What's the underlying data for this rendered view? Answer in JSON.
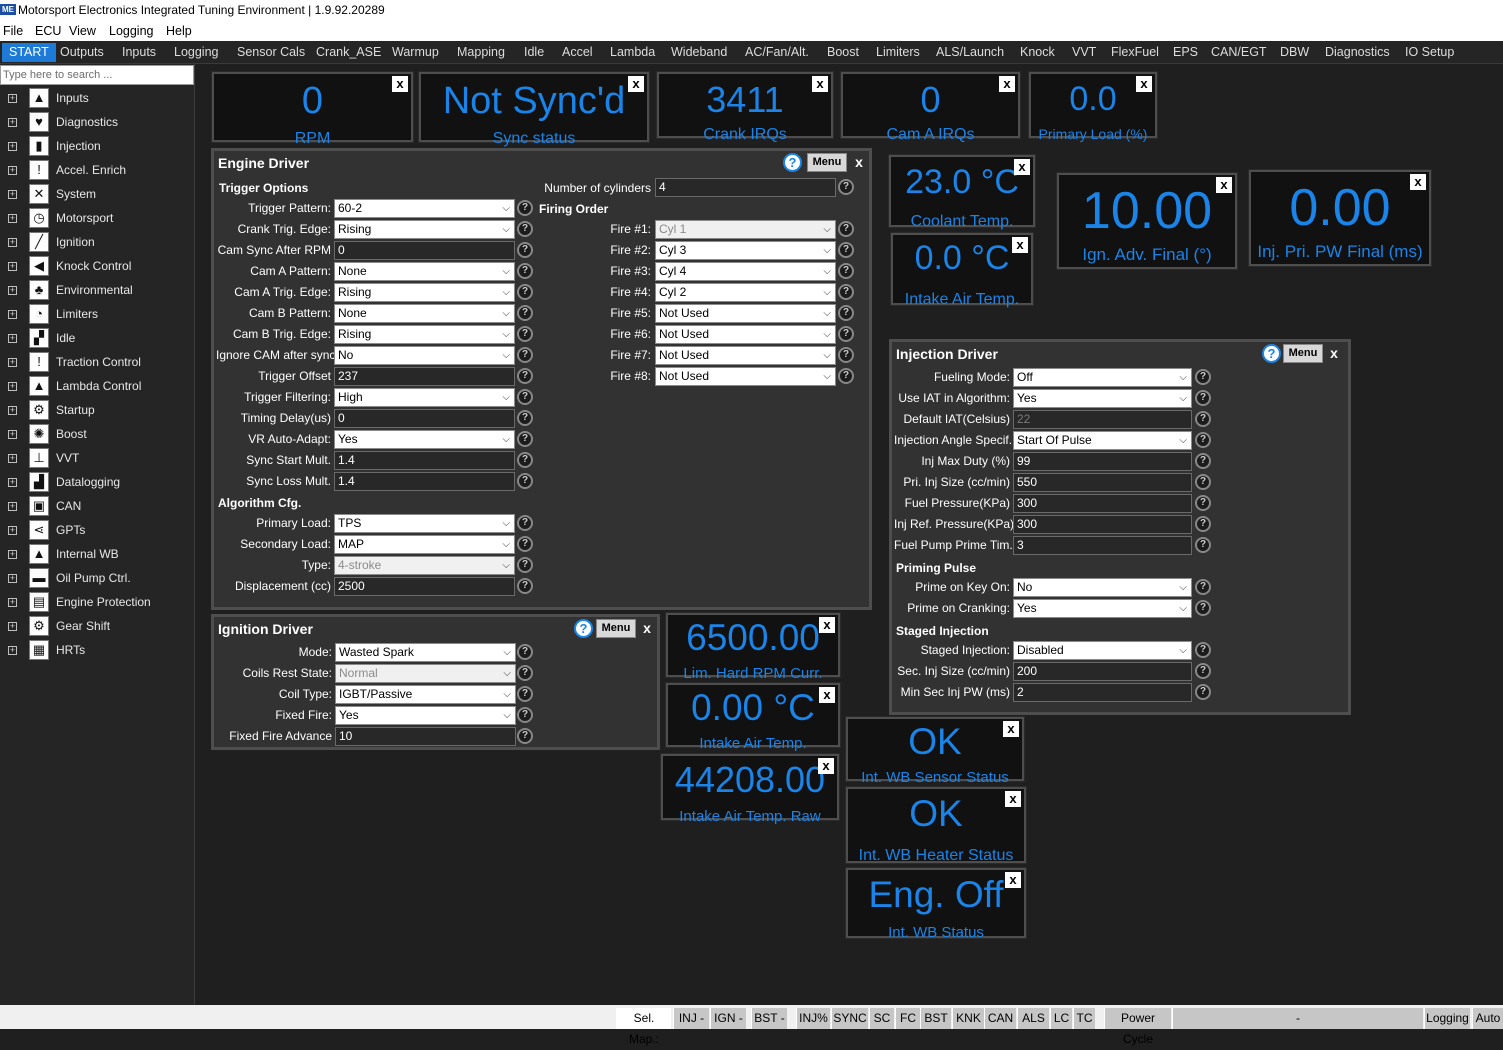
{
  "window": {
    "title": "Motorsport Electronics Integrated Tuning Environment | 1.9.92.20289",
    "logo": "ME"
  },
  "menu": [
    "File",
    "ECU",
    "View",
    "Logging",
    "Help"
  ],
  "tabs": [
    "START",
    "Outputs",
    "Inputs",
    "Logging",
    "Sensor Cals",
    "Crank_ASE",
    "Warmup",
    "Mapping",
    "Idle",
    "Accel",
    "Lambda",
    "Wideband",
    "AC/Fan/Alt.",
    "Boost",
    "Limiters",
    "ALS/Launch",
    "Knock",
    "VVT",
    "FlexFuel",
    "EPS",
    "CAN/EGT",
    "DBW",
    "Diagnostics",
    "IO Setup"
  ],
  "search": {
    "placeholder": "Type here to search ..."
  },
  "sidebar": [
    {
      "label": "Inputs",
      "icon": "inputs-icon",
      "glyph": "▲"
    },
    {
      "label": "Diagnostics",
      "icon": "heart-icon",
      "glyph": "♥"
    },
    {
      "label": "Injection",
      "icon": "injector-icon",
      "glyph": "▮"
    },
    {
      "label": "Accel. Enrich",
      "icon": "warning-icon",
      "glyph": "!"
    },
    {
      "label": "System",
      "icon": "tools-icon",
      "glyph": "✕"
    },
    {
      "label": "Motorsport",
      "icon": "stopwatch-icon",
      "glyph": "◷"
    },
    {
      "label": "Ignition",
      "icon": "spark-plug-icon",
      "glyph": "╱"
    },
    {
      "label": "Knock Control",
      "icon": "speaker-icon",
      "glyph": "◀"
    },
    {
      "label": "Environmental",
      "icon": "tree-icon",
      "glyph": "♣"
    },
    {
      "label": "Limiters",
      "icon": "clock-icon",
      "glyph": "◔"
    },
    {
      "label": "Idle",
      "icon": "idle-icon",
      "glyph": "▞"
    },
    {
      "label": "Traction Control",
      "icon": "warning-icon",
      "glyph": "!"
    },
    {
      "label": "Lambda Control",
      "icon": "flask-icon",
      "glyph": "▲"
    },
    {
      "label": "Startup",
      "icon": "gears-icon",
      "glyph": "⚙"
    },
    {
      "label": "Boost",
      "icon": "turbo-icon",
      "glyph": "✺"
    },
    {
      "label": "VVT",
      "icon": "valve-icon",
      "glyph": "⊥"
    },
    {
      "label": "Datalogging",
      "icon": "chart-icon",
      "glyph": "▟"
    },
    {
      "label": "CAN",
      "icon": "save-icon",
      "glyph": "▣"
    },
    {
      "label": "GPTs",
      "icon": "share-icon",
      "glyph": "⋖"
    },
    {
      "label": "Internal WB",
      "icon": "flask-icon",
      "glyph": "▲"
    },
    {
      "label": "Oil Pump Ctrl.",
      "icon": "oil-can-icon",
      "glyph": "▬"
    },
    {
      "label": "Engine Protection",
      "icon": "battery-icon",
      "glyph": "▤"
    },
    {
      "label": "Gear Shift",
      "icon": "gears-icon",
      "glyph": "⚙"
    },
    {
      "label": "HRTs",
      "icon": "grid-icon",
      "glyph": "▦"
    }
  ],
  "gauges": {
    "rpm": {
      "value": "0",
      "label": "RPM"
    },
    "sync": {
      "value": "Not Sync'd",
      "label": "Sync status"
    },
    "crank": {
      "value": "3411",
      "label": "Crank IRQs"
    },
    "cam": {
      "value": "0",
      "label": "Cam A IRQs"
    },
    "load": {
      "value": "0.0",
      "label": "Primary Load (%)"
    },
    "coolant": {
      "value": "23.0 °C",
      "label": "Coolant Temp."
    },
    "iat": {
      "value": "0.0 °C",
      "label": "Intake Air Temp."
    },
    "ignadv": {
      "value": "10.00",
      "label": "Ign. Adv. Final (°)"
    },
    "injpw": {
      "value": "0.00",
      "label": "Inj. Pri. PW Final (ms)"
    },
    "limrpm": {
      "value": "6500.00",
      "label": "Lim. Hard RPM Curr."
    },
    "iat2": {
      "value": "0.00 °C",
      "label": "Intake Air Temp."
    },
    "iatraw": {
      "value": "44208.00",
      "label": "Intake Air Temp. Raw"
    },
    "wbsensor": {
      "value": "OK",
      "label": "Int. WB Sensor Status"
    },
    "wbheater": {
      "value": "OK",
      "label": "Int. WB Heater Status"
    },
    "wbstatus": {
      "value": "Eng. Off",
      "label": "Int. WB Status"
    }
  },
  "close_glyph": "x",
  "help_glyph": "?",
  "menu_label": "Menu",
  "engine": {
    "title": "Engine Driver",
    "trigger_section": "Trigger Options",
    "firing_section": "Firing Order",
    "algo_section": "Algorithm Cfg.",
    "ncyl": {
      "label": "Number of cylinders",
      "value": "4"
    },
    "trigger_fields": [
      {
        "label": "Trigger Pattern:",
        "value": "60-2",
        "kind": "sel"
      },
      {
        "label": "Crank Trig. Edge:",
        "value": "Rising",
        "kind": "sel"
      },
      {
        "label": "Cam Sync After RPM",
        "value": "0",
        "kind": "inp"
      },
      {
        "label": "Cam A Pattern:",
        "value": "None",
        "kind": "sel"
      },
      {
        "label": "Cam A Trig. Edge:",
        "value": "Rising",
        "kind": "sel"
      },
      {
        "label": "Cam B Pattern:",
        "value": "None",
        "kind": "sel"
      },
      {
        "label": "Cam B Trig. Edge:",
        "value": "Rising",
        "kind": "sel"
      },
      {
        "label": "Ignore CAM after sync:",
        "value": "No",
        "kind": "sel"
      },
      {
        "label": "Trigger Offset",
        "value": "237",
        "kind": "inp"
      },
      {
        "label": "Trigger Filtering:",
        "value": "High",
        "kind": "sel"
      },
      {
        "label": "Timing Delay(us)",
        "value": "0",
        "kind": "inp"
      },
      {
        "label": "VR Auto-Adapt:",
        "value": "Yes",
        "kind": "sel"
      },
      {
        "label": "Sync Start Mult.",
        "value": "1.4",
        "kind": "inp"
      },
      {
        "label": "Sync Loss Mult.",
        "value": "1.4",
        "kind": "inp"
      }
    ],
    "algo_fields": [
      {
        "label": "Primary Load:",
        "value": "TPS",
        "kind": "sel"
      },
      {
        "label": "Secondary Load:",
        "value": "MAP",
        "kind": "sel"
      },
      {
        "label": "Type:",
        "value": "4-stroke",
        "kind": "seldis"
      },
      {
        "label": "Displacement (cc)",
        "value": "2500",
        "kind": "inp"
      }
    ],
    "fire": [
      {
        "label": "Fire #1:",
        "value": "Cyl 1",
        "kind": "seldis"
      },
      {
        "label": "Fire #2:",
        "value": "Cyl 3",
        "kind": "sel"
      },
      {
        "label": "Fire #3:",
        "value": "Cyl 4",
        "kind": "sel"
      },
      {
        "label": "Fire #4:",
        "value": "Cyl 2",
        "kind": "sel"
      },
      {
        "label": "Fire #5:",
        "value": "Not Used",
        "kind": "sel"
      },
      {
        "label": "Fire #6:",
        "value": "Not Used",
        "kind": "sel"
      },
      {
        "label": "Fire #7:",
        "value": "Not Used",
        "kind": "sel"
      },
      {
        "label": "Fire #8:",
        "value": "Not Used",
        "kind": "sel"
      }
    ]
  },
  "ignition": {
    "title": "Ignition Driver",
    "fields": [
      {
        "label": "Mode:",
        "value": "Wasted Spark",
        "kind": "sel"
      },
      {
        "label": "Coils Rest State:",
        "value": "Normal",
        "kind": "seldis"
      },
      {
        "label": "Coil Type:",
        "value": "IGBT/Passive",
        "kind": "sel"
      },
      {
        "label": "Fixed Fire:",
        "value": "Yes",
        "kind": "sel"
      },
      {
        "label": "Fixed Fire Advance",
        "value": "10",
        "kind": "inp"
      }
    ]
  },
  "injection": {
    "title": "Injection Driver",
    "priming_section": "Priming Pulse",
    "staged_section": "Staged Injection",
    "fields": [
      {
        "label": "Fueling Mode:",
        "value": "Off",
        "kind": "sel"
      },
      {
        "label": "Use IAT in Algorithm:",
        "value": "Yes",
        "kind": "sel"
      },
      {
        "label": "Default IAT(Celsius)",
        "value": "22",
        "kind": "inpdis"
      },
      {
        "label": "Injection Angle Specif...",
        "value": "Start Of Pulse",
        "kind": "sel"
      },
      {
        "label": "Inj Max Duty (%)",
        "value": "99",
        "kind": "inp"
      },
      {
        "label": "Pri. Inj Size (cc/min)",
        "value": "550",
        "kind": "inp"
      },
      {
        "label": "Fuel Pressure(KPa)",
        "value": "300",
        "kind": "inp"
      },
      {
        "label": "Inj Ref. Pressure(KPa)",
        "value": "300",
        "kind": "inp"
      },
      {
        "label": "Fuel Pump Prime Tim...",
        "value": "3",
        "kind": "inp"
      }
    ],
    "priming": [
      {
        "label": "Prime on Key On:",
        "value": "No",
        "kind": "sel"
      },
      {
        "label": "Prime on Cranking:",
        "value": "Yes",
        "kind": "sel"
      }
    ],
    "staged": [
      {
        "label": "Staged Injection:",
        "value": "Disabled",
        "kind": "sel"
      },
      {
        "label": "Sec. Inj Size (cc/min)",
        "value": "200",
        "kind": "inp"
      },
      {
        "label": "Min Sec Inj PW (ms)",
        "value": "2",
        "kind": "inp"
      }
    ]
  },
  "status": [
    {
      "label": "Sel. Map.:",
      "style": "w"
    },
    {
      "label": "INJ -",
      "style": ""
    },
    {
      "label": "IGN -",
      "style": ""
    },
    {
      "label": "BST -",
      "style": ""
    },
    {
      "label": "INJ%",
      "style": ""
    },
    {
      "label": "SYNC",
      "style": ""
    },
    {
      "label": "SC",
      "style": ""
    },
    {
      "label": "FC",
      "style": ""
    },
    {
      "label": "BST",
      "style": ""
    },
    {
      "label": "KNK",
      "style": ""
    },
    {
      "label": "CAN",
      "style": ""
    },
    {
      "label": "ALS",
      "style": ""
    },
    {
      "label": "LC",
      "style": ""
    },
    {
      "label": "TC",
      "style": ""
    },
    {
      "label": "Power Cycle",
      "style": ""
    },
    {
      "label": "-",
      "style": ""
    },
    {
      "label": "Logging",
      "style": ""
    },
    {
      "label": "Auto",
      "style": ""
    }
  ]
}
